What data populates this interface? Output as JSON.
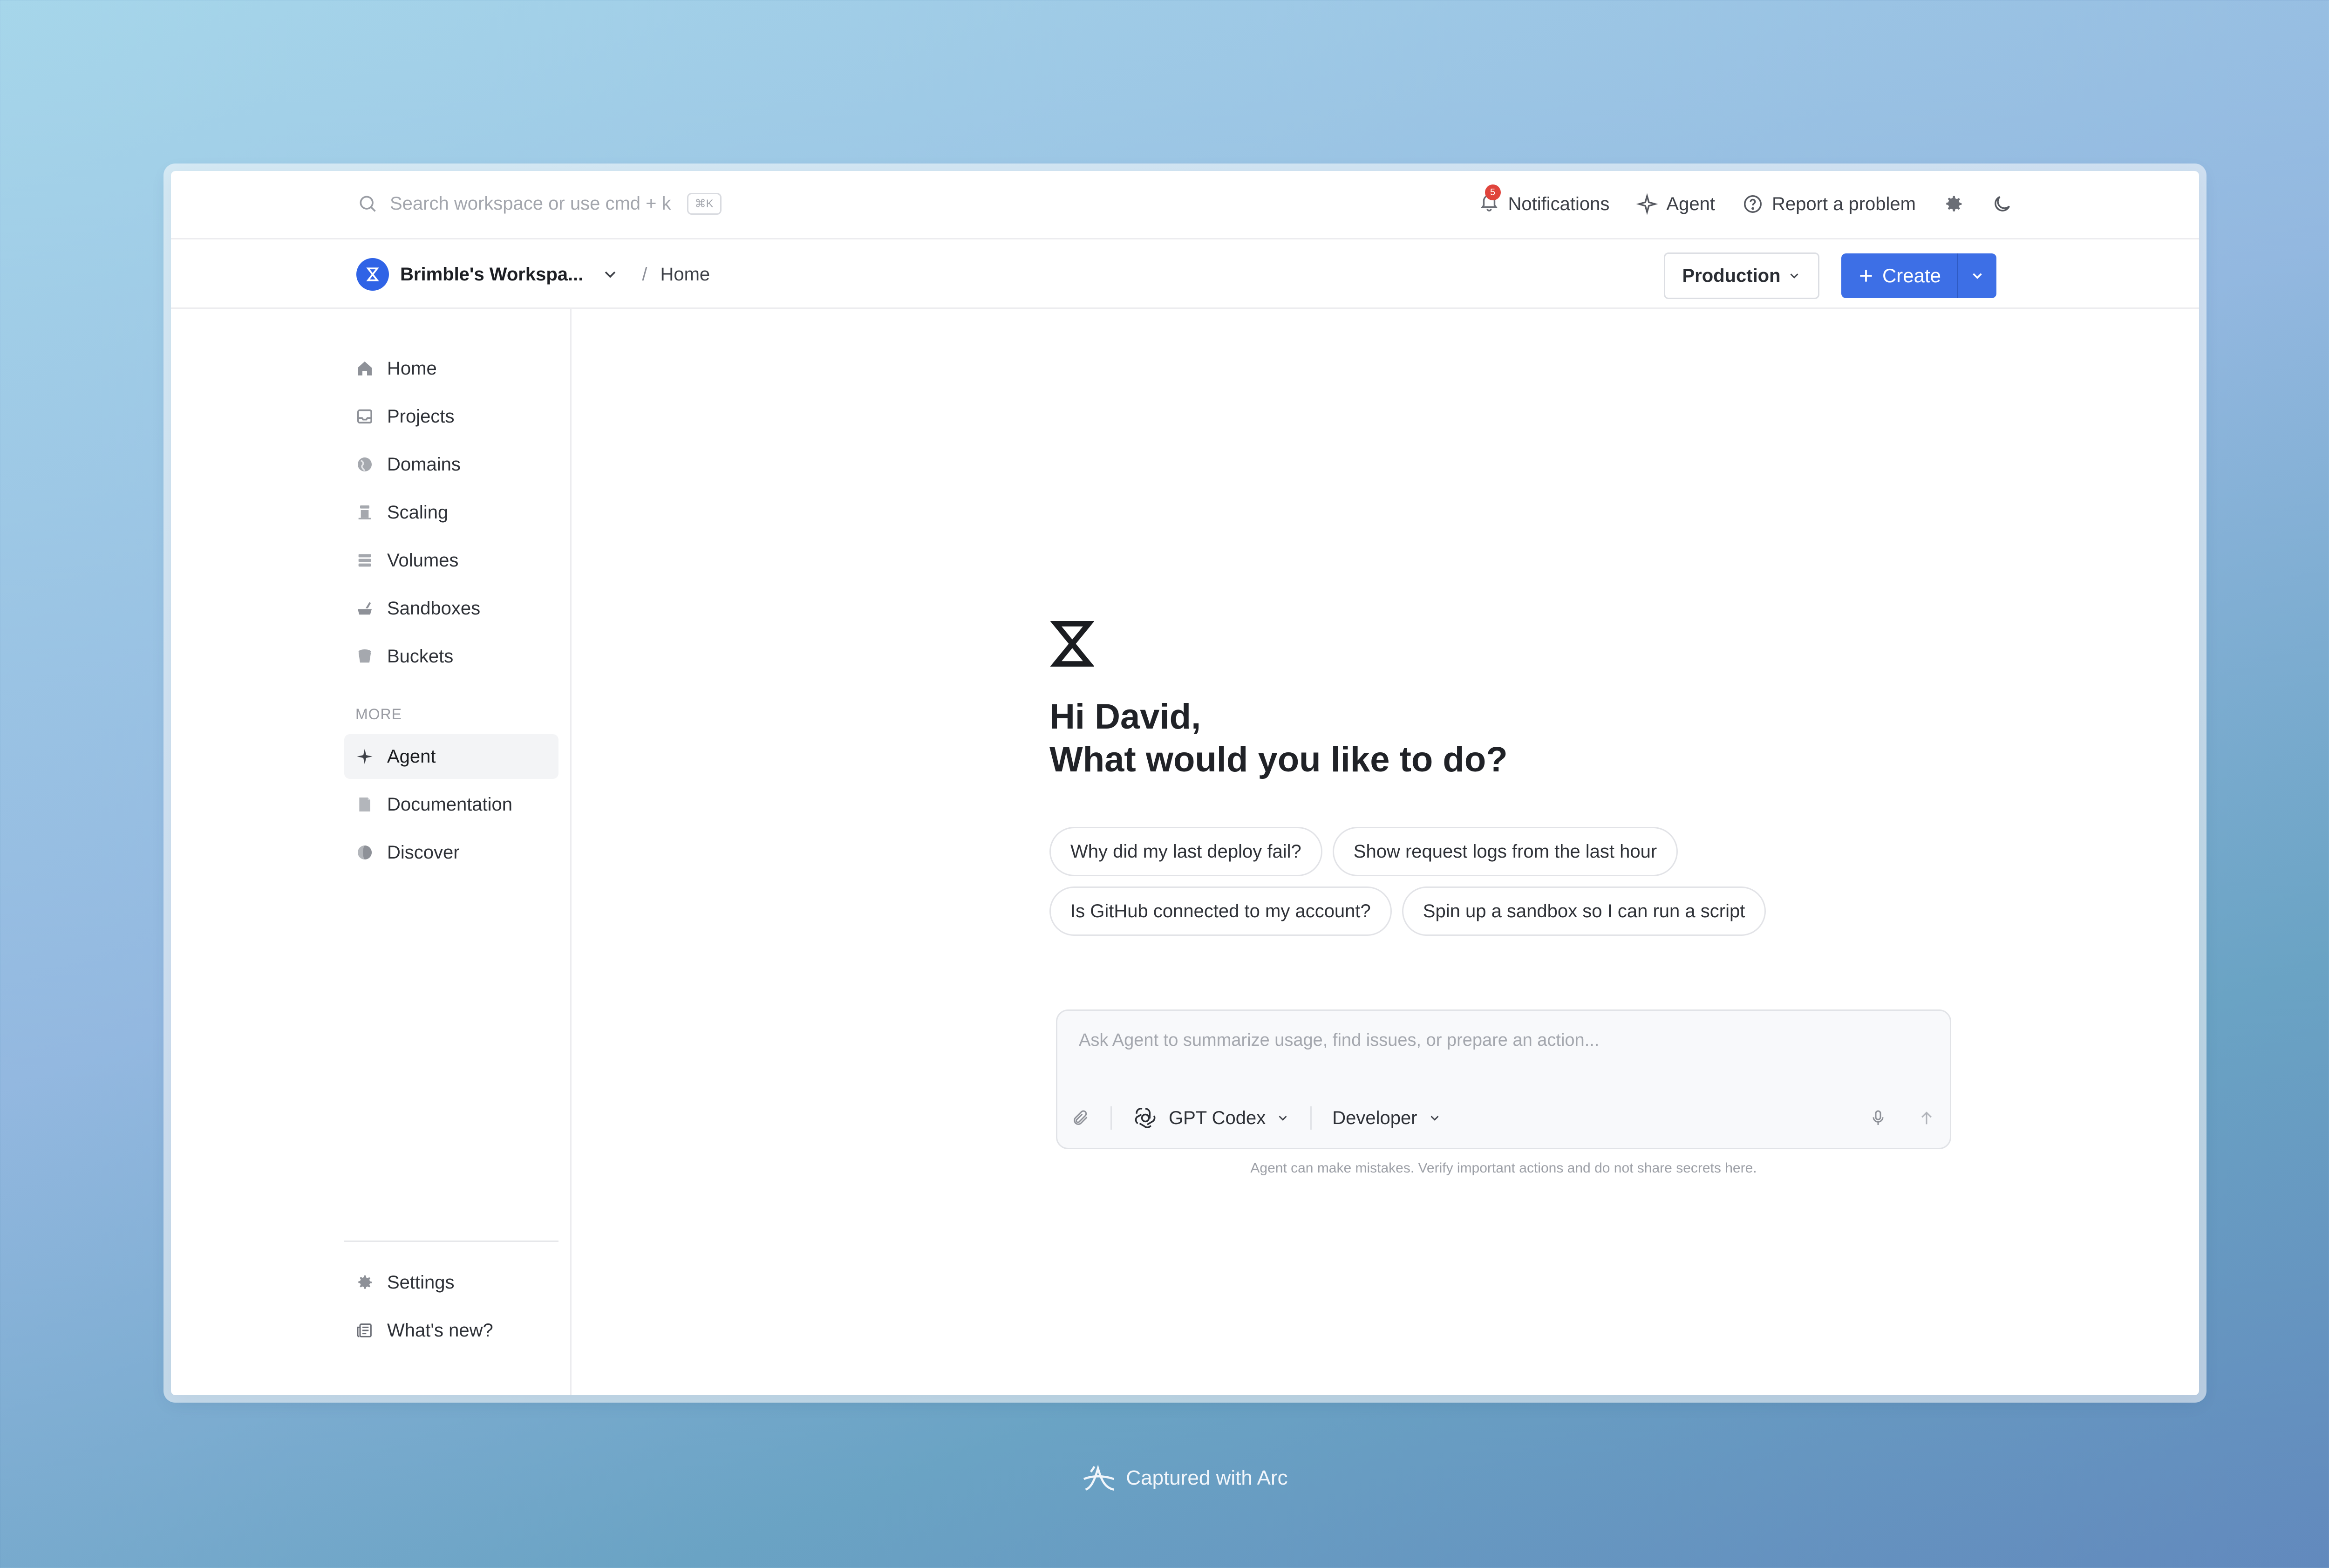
{
  "topbar": {
    "search_placeholder": "Search workspace or use cmd + k",
    "search_kbd": "⌘K",
    "notifications_label": "Notifications",
    "notifications_count": "5",
    "agent_label": "Agent",
    "report_label": "Report a problem"
  },
  "breadcrumb": {
    "workspace_name": "Brimble's Workspa...",
    "separator": "/",
    "current": "Home"
  },
  "header_actions": {
    "environment": "Production",
    "create_label": "Create"
  },
  "sidebar": {
    "items": [
      {
        "label": "Home",
        "icon": "home-icon"
      },
      {
        "label": "Projects",
        "icon": "projects-icon"
      },
      {
        "label": "Domains",
        "icon": "domains-icon"
      },
      {
        "label": "Scaling",
        "icon": "scaling-icon"
      },
      {
        "label": "Volumes",
        "icon": "volumes-icon"
      },
      {
        "label": "Sandboxes",
        "icon": "sandboxes-icon"
      },
      {
        "label": "Buckets",
        "icon": "buckets-icon"
      }
    ],
    "more_heading": "MORE",
    "more_items": [
      {
        "label": "Agent",
        "icon": "sparkle-icon",
        "active": true
      },
      {
        "label": "Documentation",
        "icon": "document-icon"
      },
      {
        "label": "Discover",
        "icon": "discover-icon"
      }
    ],
    "bottom_items": [
      {
        "label": "Settings",
        "icon": "gear-icon"
      },
      {
        "label": "What's new?",
        "icon": "newspaper-icon"
      }
    ]
  },
  "main": {
    "greeting_line1": "Hi David,",
    "greeting_line2": "What would you like to do?",
    "suggestions": [
      "Why did my last deploy fail?",
      "Show request logs from the last hour",
      "Is GitHub connected to my account?",
      "Spin up a sandbox so I can run a script"
    ],
    "prompt_placeholder": "Ask Agent to summarize usage, find issues, or prepare an action...",
    "model": "GPT Codex",
    "mode": "Developer",
    "disclaimer": "Agent can make mistakes. Verify important actions and do not share secrets here."
  },
  "footer": {
    "capture_label": "Captured with Arc"
  },
  "colors": {
    "accent": "#3d6fe6",
    "badge": "#e0443c"
  }
}
